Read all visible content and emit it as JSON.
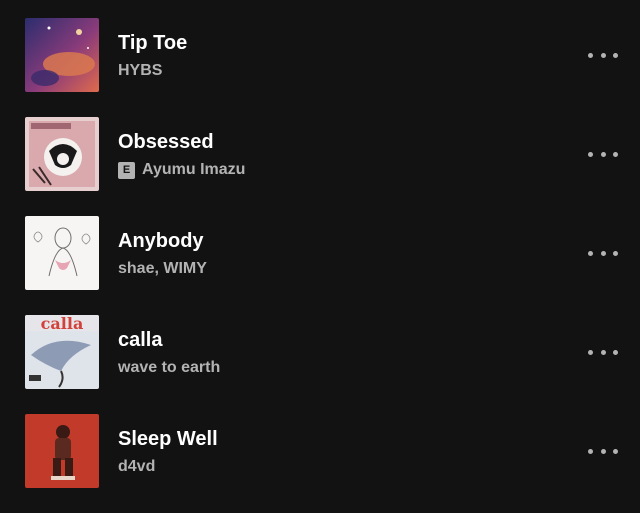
{
  "tracks": [
    {
      "title": "Tip Toe",
      "artist": "HYBS",
      "explicit": false,
      "cover_icon": "album-art"
    },
    {
      "title": "Obsessed",
      "artist": "Ayumu Imazu",
      "explicit": true,
      "explicit_label": "E",
      "cover_icon": "album-art"
    },
    {
      "title": "Anybody",
      "artist": "shae, WIMY",
      "explicit": false,
      "cover_icon": "album-art"
    },
    {
      "title": "calla",
      "artist": "wave to earth",
      "explicit": false,
      "cover_icon": "album-art"
    },
    {
      "title": "Sleep Well",
      "artist": "d4vd",
      "explicit": false,
      "cover_icon": "album-art"
    }
  ],
  "more_icon": "more-options-icon",
  "colors": {
    "background": "#121212",
    "title": "#ffffff",
    "subtitle": "#b3b3b3"
  }
}
